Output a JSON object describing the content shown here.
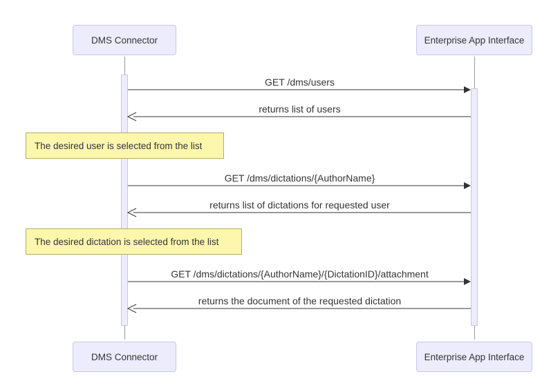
{
  "diagram": {
    "type": "sequence",
    "participants": {
      "left": "DMS Connector",
      "right": "Enterprise App Interface"
    },
    "interactions": [
      {
        "kind": "message",
        "from": "left",
        "to": "right",
        "arrow": "solid",
        "label": "GET /dms/users"
      },
      {
        "kind": "message",
        "from": "right",
        "to": "left",
        "arrow": "open",
        "label": "returns list of users"
      },
      {
        "kind": "note",
        "label": "The desired user is selected from the list"
      },
      {
        "kind": "message",
        "from": "left",
        "to": "right",
        "arrow": "solid",
        "label": "GET /dms/dictations/{AuthorName}"
      },
      {
        "kind": "message",
        "from": "right",
        "to": "left",
        "arrow": "open",
        "label": "returns list of dictations for requested user"
      },
      {
        "kind": "note",
        "label": "The desired dictation is selected from the list"
      },
      {
        "kind": "message",
        "from": "left",
        "to": "right",
        "arrow": "solid",
        "label": "GET /dms/dictations/{AuthorName}/{DictationID}/attachment"
      },
      {
        "kind": "message",
        "from": "right",
        "to": "left",
        "arrow": "open",
        "label": "returns the document of the requested dictation"
      }
    ]
  },
  "colors": {
    "participantFill": "#ececfd",
    "participantBorder": "#c6c6ec",
    "noteFill": "#fdf7ad",
    "noteBorder": "#b3ad5f",
    "line": "#333333"
  }
}
